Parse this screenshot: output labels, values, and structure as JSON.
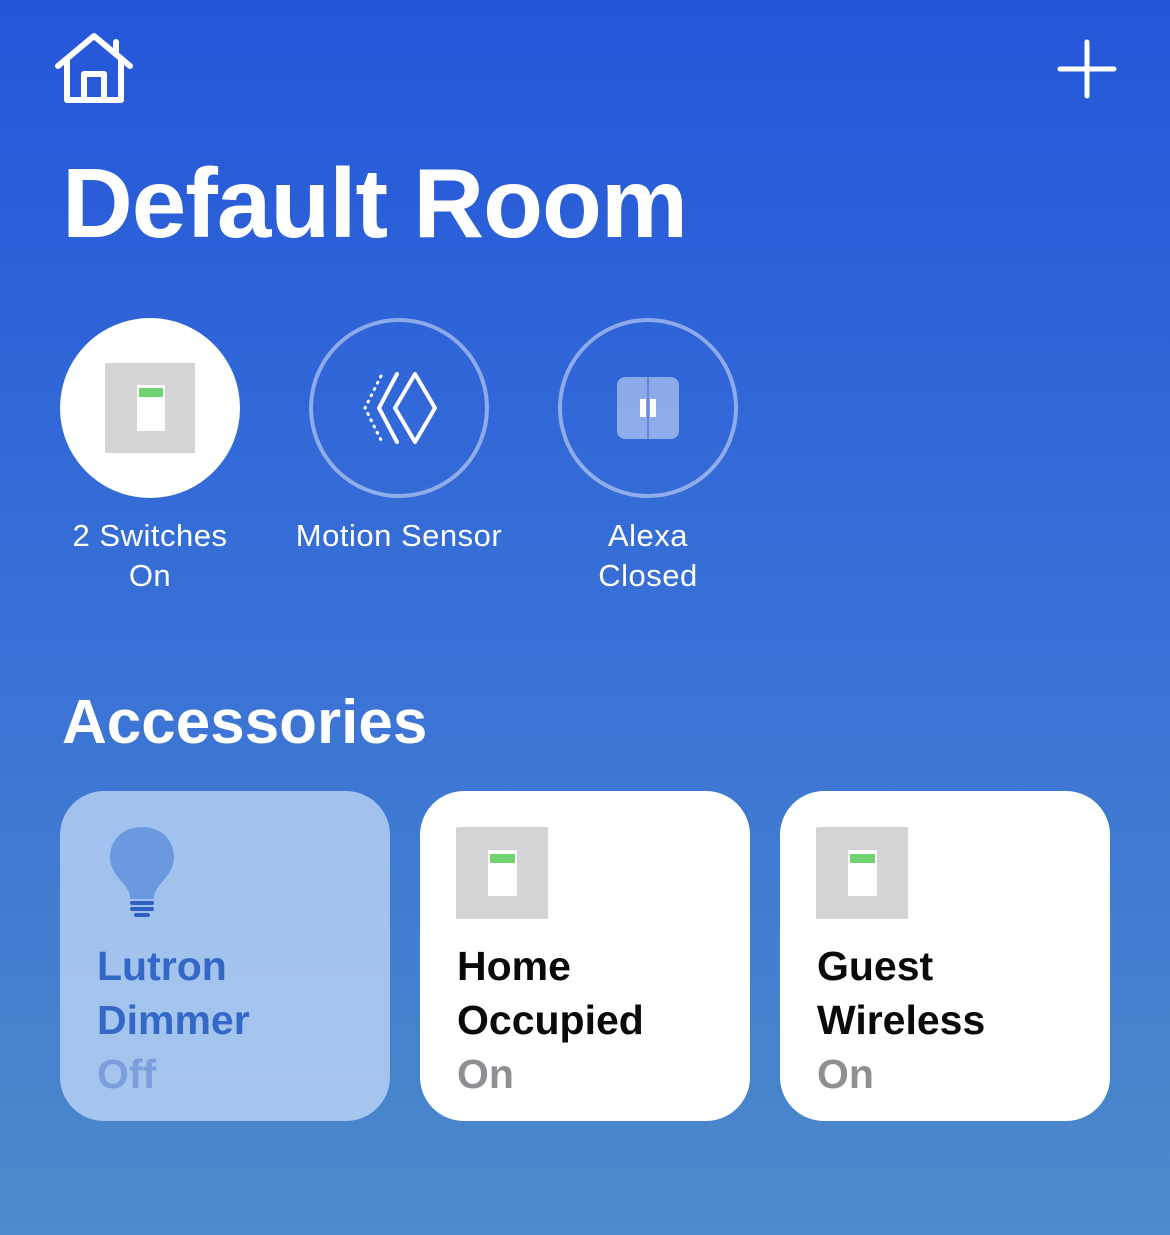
{
  "header": {
    "home_icon": "home-icon",
    "add_icon": "plus-icon",
    "title": "Default Room"
  },
  "status_items": [
    {
      "icon": "switch-icon",
      "line1": "2 Switches",
      "line2": "On",
      "active": true
    },
    {
      "icon": "motion-sensor-icon",
      "line1": "Motion Sensor",
      "line2": "",
      "active": false
    },
    {
      "icon": "blinds-icon",
      "line1": "Alexa",
      "line2": "Closed",
      "active": false
    }
  ],
  "accessories": {
    "title": "Accessories",
    "tiles": [
      {
        "icon": "lightbulb-icon",
        "name_line1": "Lutron",
        "name_line2": "Dimmer",
        "state": "Off",
        "on": false
      },
      {
        "icon": "switch-icon",
        "name_line1": "Home",
        "name_line2": "Occupied",
        "state": "On",
        "on": true
      },
      {
        "icon": "switch-icon",
        "name_line1": "Guest",
        "name_line2": "Wireless",
        "state": "On",
        "on": true
      }
    ]
  },
  "colors": {
    "background_top": "#2456d9",
    "background_bottom": "#4d8ac9",
    "switch_led": "#6fd46f",
    "tile_off_text": "#3468c8"
  }
}
